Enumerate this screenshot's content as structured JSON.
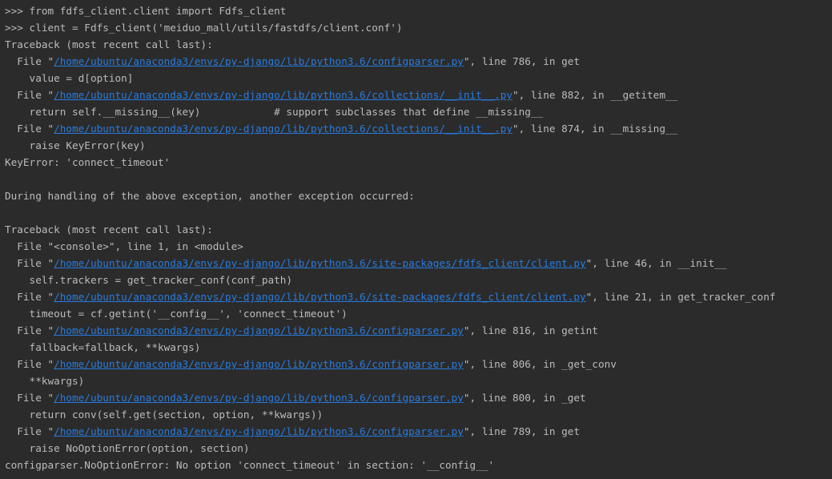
{
  "console": {
    "colors": {
      "background": "#2b2b2b",
      "text": "#bbbbbb",
      "link": "#287bde"
    },
    "lines": [
      {
        "parts": [
          {
            "text": ">>> from fdfs_client.client import Fdfs_client"
          }
        ]
      },
      {
        "parts": [
          {
            "text": ">>> client = Fdfs_client('meiduo_mall/utils/fastdfs/client.conf')"
          }
        ]
      },
      {
        "parts": [
          {
            "text": "Traceback (most recent call last):"
          }
        ]
      },
      {
        "parts": [
          {
            "text": "  File \""
          },
          {
            "text": "/home/ubuntu/anaconda3/envs/py-django/lib/python3.6/configparser.py",
            "link": true
          },
          {
            "text": "\", line 786, in get"
          }
        ]
      },
      {
        "parts": [
          {
            "text": "    value = d[option]"
          }
        ]
      },
      {
        "parts": [
          {
            "text": "  File \""
          },
          {
            "text": "/home/ubuntu/anaconda3/envs/py-django/lib/python3.6/collections/__init__.py",
            "link": true
          },
          {
            "text": "\", line 882, in __getitem__"
          }
        ]
      },
      {
        "parts": [
          {
            "text": "    return self.__missing__(key)            # support subclasses that define __missing__"
          }
        ]
      },
      {
        "parts": [
          {
            "text": "  File \""
          },
          {
            "text": "/home/ubuntu/anaconda3/envs/py-django/lib/python3.6/collections/__init__.py",
            "link": true
          },
          {
            "text": "\", line 874, in __missing__"
          }
        ]
      },
      {
        "parts": [
          {
            "text": "    raise KeyError(key)"
          }
        ]
      },
      {
        "parts": [
          {
            "text": "KeyError: 'connect_timeout'"
          }
        ]
      },
      {
        "parts": [
          {
            "text": ""
          }
        ]
      },
      {
        "parts": [
          {
            "text": "During handling of the above exception, another exception occurred:"
          }
        ]
      },
      {
        "parts": [
          {
            "text": ""
          }
        ]
      },
      {
        "parts": [
          {
            "text": "Traceback (most recent call last):"
          }
        ]
      },
      {
        "parts": [
          {
            "text": "  File \"<console>\", line 1, in <module>"
          }
        ]
      },
      {
        "parts": [
          {
            "text": "  File \""
          },
          {
            "text": "/home/ubuntu/anaconda3/envs/py-django/lib/python3.6/site-packages/fdfs_client/client.py",
            "link": true
          },
          {
            "text": "\", line 46, in __init__"
          }
        ]
      },
      {
        "parts": [
          {
            "text": "    self.trackers = get_tracker_conf(conf_path)"
          }
        ]
      },
      {
        "parts": [
          {
            "text": "  File \""
          },
          {
            "text": "/home/ubuntu/anaconda3/envs/py-django/lib/python3.6/site-packages/fdfs_client/client.py",
            "link": true
          },
          {
            "text": "\", line 21, in get_tracker_conf"
          }
        ]
      },
      {
        "parts": [
          {
            "text": "    timeout = cf.getint('__config__', 'connect_timeout')"
          }
        ]
      },
      {
        "parts": [
          {
            "text": "  File \""
          },
          {
            "text": "/home/ubuntu/anaconda3/envs/py-django/lib/python3.6/configparser.py",
            "link": true
          },
          {
            "text": "\", line 816, in getint"
          }
        ]
      },
      {
        "parts": [
          {
            "text": "    fallback=fallback, **kwargs)"
          }
        ]
      },
      {
        "parts": [
          {
            "text": "  File \""
          },
          {
            "text": "/home/ubuntu/anaconda3/envs/py-django/lib/python3.6/configparser.py",
            "link": true
          },
          {
            "text": "\", line 806, in _get_conv"
          }
        ]
      },
      {
        "parts": [
          {
            "text": "    **kwargs)"
          }
        ]
      },
      {
        "parts": [
          {
            "text": "  File \""
          },
          {
            "text": "/home/ubuntu/anaconda3/envs/py-django/lib/python3.6/configparser.py",
            "link": true
          },
          {
            "text": "\", line 800, in _get"
          }
        ]
      },
      {
        "parts": [
          {
            "text": "    return conv(self.get(section, option, **kwargs))"
          }
        ]
      },
      {
        "parts": [
          {
            "text": "  File \""
          },
          {
            "text": "/home/ubuntu/anaconda3/envs/py-django/lib/python3.6/configparser.py",
            "link": true
          },
          {
            "text": "\", line 789, in get"
          }
        ]
      },
      {
        "parts": [
          {
            "text": "    raise NoOptionError(option, section)"
          }
        ]
      },
      {
        "parts": [
          {
            "text": "configparser.NoOptionError: No option 'connect_timeout' in section: '__config__'"
          }
        ]
      }
    ]
  }
}
